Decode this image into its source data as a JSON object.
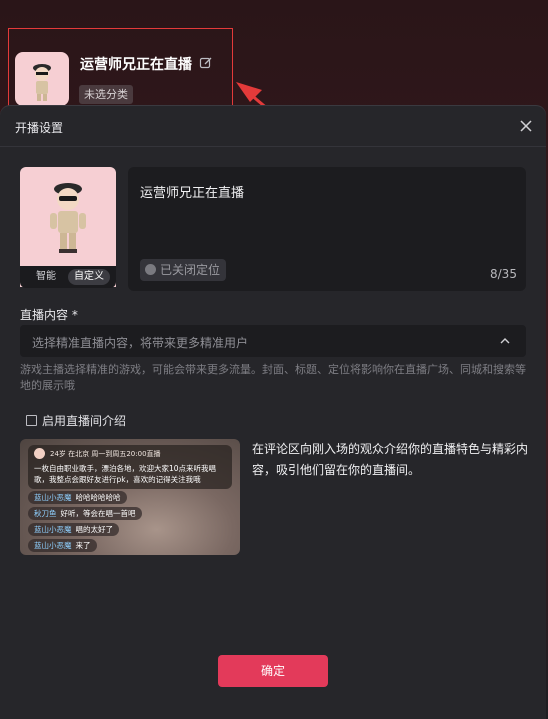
{
  "header": {
    "room_title": "运营师兄正在直播",
    "category": "未选分类",
    "highlight_color": "#e33a3a"
  },
  "dialog": {
    "title": "开播设置",
    "cover": {
      "mode_options": [
        "智能",
        "自定义"
      ],
      "selected_mode": "自定义"
    },
    "title_input": {
      "value": "运营师兄正在直播",
      "location_chip": "已关闭定位",
      "counter": "8/35"
    },
    "content_section": {
      "label": "直播内容 *",
      "placeholder": "选择精准直播内容，将带来更多精准用户",
      "hint": "游戏主播选择精准的游戏，可能会带来更多流量。封面、标题、定位将影响你在直播广场、同城和搜索等地的展示哦"
    },
    "intro": {
      "checkbox_label": "启用直播间介绍",
      "checked": false,
      "preview_card_meta": "24岁  在北京  周一到周五20:00直播",
      "preview_card_text": "一枚自由职业歌手，漂泊各地，欢迎大家10点来听我唱歌，我整点会跟好友进行pk，喜欢的记得关注我哦",
      "comments": [
        {
          "name": "蓝山小恶魔",
          "text": "哈哈哈哈哈哈"
        },
        {
          "name": "秋刀鱼",
          "text": "好听，等会在唱一首吧"
        },
        {
          "name": "蓝山小恶魔",
          "text": "唱的太好了"
        },
        {
          "name": "蓝山小恶魔",
          "text": "来了"
        }
      ],
      "description": "在评论区向刚入场的观众介绍你的直播特色与精彩内容，吸引他们留在你的直播间。"
    },
    "confirm_label": "确定",
    "accent_color": "#e33a5a"
  }
}
